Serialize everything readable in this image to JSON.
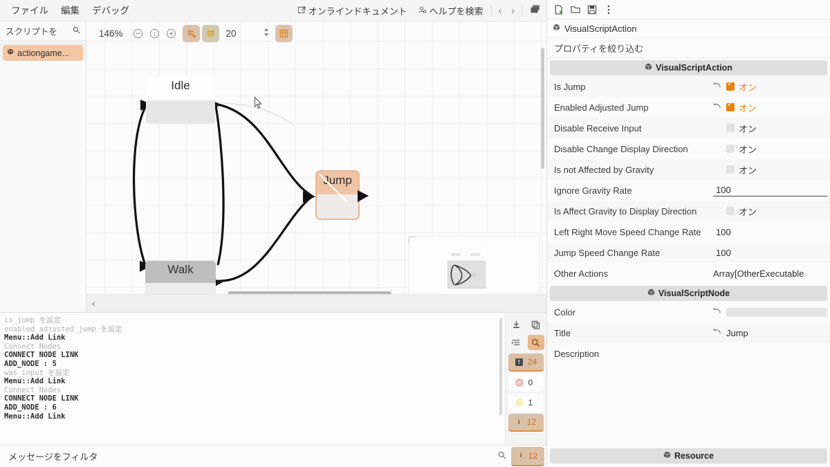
{
  "menubar": {
    "items": [
      "ファイル",
      "編集",
      "デバッグ"
    ],
    "online_doc": "オンラインドキュメント",
    "search_help": "ヘルプを検索",
    "online_doc_icon": "external-link-icon",
    "search_help_icon": "help-search-icon",
    "nav_back_icon": "chevron-left-icon",
    "nav_forward_icon": "chevron-right-icon",
    "window_icon": "window-layers-icon"
  },
  "script_panel": {
    "search_placeholder": "スクリプトを",
    "search_icon": "search-icon",
    "items": [
      {
        "label": "actiongame...",
        "icon": "godot-script-icon",
        "selected": true
      }
    ]
  },
  "graph_toolbar": {
    "zoom_level": "146%",
    "zoom_out_icon": "minus-circle-icon",
    "zoom_reset_icon": "one-circle-icon",
    "zoom_in_icon": "plus-circle-icon",
    "snap_toggle_icon": "grid-snap-icon",
    "grid_toggle_icon": "grid-icon",
    "grid_step": "20",
    "stepper_icon": "updown-spinner-icon",
    "layout_icon": "grid-layout-icon"
  },
  "graph": {
    "nodes": [
      {
        "id": "idle",
        "title": "Idle",
        "selected": false
      },
      {
        "id": "walk",
        "title": "Walk",
        "selected": false
      },
      {
        "id": "jump",
        "title": "Jump",
        "selected": true
      }
    ],
    "minimap_label": "minimap",
    "collapse_icon": "chevron-left-icon"
  },
  "log": {
    "lines": [
      {
        "text": "is_jump を設定",
        "style": "dim"
      },
      {
        "text": "enabled_adjusted_jump を設定",
        "style": "dim"
      },
      {
        "text": "Menu::Add Link",
        "style": "bold"
      },
      {
        "text": "Connect Nodes",
        "style": "dim"
      },
      {
        "text": "CONNECT NODE LINK",
        "style": "bold"
      },
      {
        "text": "ADD_NODE : 5",
        "style": "bold"
      },
      {
        "text": "was_input を設定",
        "style": "dim"
      },
      {
        "text": "Menu::Add Link",
        "style": "bold"
      },
      {
        "text": "Connect Nodes",
        "style": "dim"
      },
      {
        "text": "CONNECT NODE LINK",
        "style": "bold"
      },
      {
        "text": "ADD_NODE : 6",
        "style": "bold"
      },
      {
        "text": "Menu::Add Link",
        "style": "bold"
      }
    ],
    "tools": {
      "clear_icon": "clear-log-icon",
      "copy_icon": "copy-icon",
      "collapse_icon": "collapse-lines-icon",
      "filter_icon": "search-filter-icon"
    },
    "counters": [
      {
        "name": "messages",
        "icon": "message-square-icon",
        "value": "24",
        "selected": true
      },
      {
        "name": "errors",
        "icon": "error-circle-icon",
        "value": "0",
        "selected": false
      },
      {
        "name": "warnings",
        "icon": "warning-circle-icon",
        "value": "1",
        "selected": false
      },
      {
        "name": "info",
        "icon": "info-icon",
        "value": "12",
        "selected": true
      }
    ]
  },
  "filter_bar": {
    "placeholder": "メッセージをフィルタ",
    "search_icon": "search-icon",
    "count_icon": "info-icon",
    "count": "12"
  },
  "inspector": {
    "toolbar_icons": [
      "new-resource-icon",
      "open-folder-icon",
      "save-icon",
      "more-vertical-icon"
    ],
    "object_name": "VisualScriptAction",
    "object_icon": "resource-cube-icon",
    "filter_placeholder": "プロパティを絞り込む",
    "sections": [
      {
        "title": "VisualScriptAction",
        "icon": "resource-cube-icon",
        "rows": [
          {
            "label": "Is Jump",
            "type": "checkbox",
            "checked": true,
            "value": "オン",
            "revert": true
          },
          {
            "label": "Enabled Adjusted Jump",
            "type": "checkbox",
            "checked": true,
            "value": "オン",
            "revert": true
          },
          {
            "label": "Disable Receive Input",
            "type": "checkbox",
            "checked": false,
            "value": "オン",
            "revert": false
          },
          {
            "label": "Disable Change Display Direction",
            "type": "checkbox",
            "checked": false,
            "value": "オン",
            "revert": false
          },
          {
            "label": "Is not Affected by Gravity",
            "type": "checkbox",
            "checked": false,
            "value": "オン",
            "revert": false
          },
          {
            "label": "Ignore Gravity Rate",
            "type": "number",
            "value": "100",
            "focused": true
          },
          {
            "label": "Is Affect Gravity to Display Direction",
            "type": "checkbox",
            "checked": false,
            "value": "オン",
            "revert": false
          },
          {
            "label": "Left Right Move Speed Change Rate",
            "type": "number",
            "value": "100",
            "focused": false
          },
          {
            "label": "Jump Speed Change Rate",
            "type": "number",
            "value": "100",
            "focused": false
          },
          {
            "label": "Other Actions",
            "type": "array",
            "value": "Array[OtherExecutable"
          }
        ]
      },
      {
        "title": "VisualScriptNode",
        "icon": "resource-cube-icon",
        "rows": [
          {
            "label": "Color",
            "type": "color",
            "value": "",
            "revert": true
          },
          {
            "label": "Title",
            "type": "text",
            "value": "Jump",
            "revert": true
          },
          {
            "label": "Description",
            "type": "text",
            "value": ""
          }
        ]
      }
    ],
    "resource_footer": {
      "label": "Resource",
      "icon": "resource-cube-icon"
    }
  },
  "colors": {
    "accent_orange": "#e8820e",
    "selection_peach": "#eec4a6",
    "panel_bg": "#fbfbfb",
    "section_header": "#dedede"
  }
}
